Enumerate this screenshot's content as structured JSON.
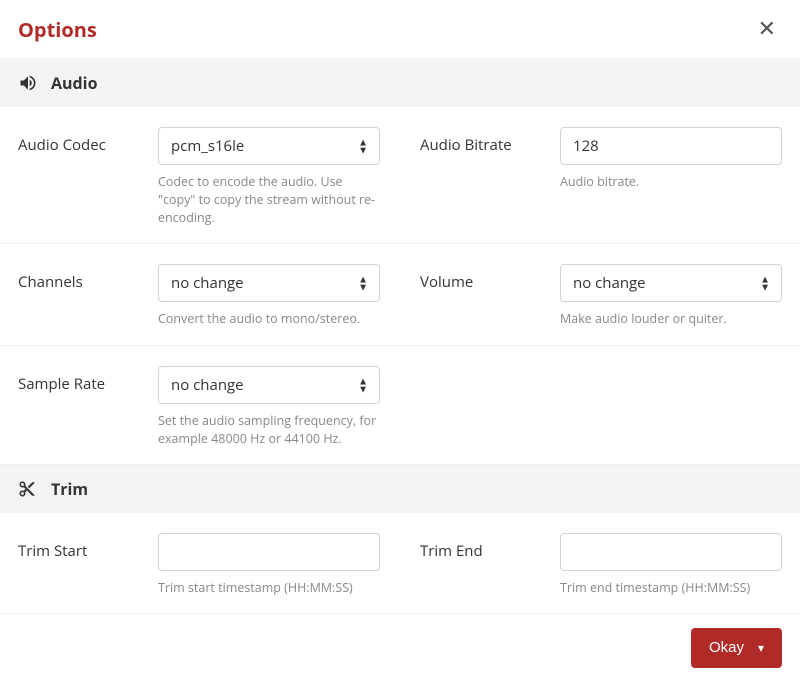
{
  "dialog": {
    "title": "Options"
  },
  "sections": {
    "audio": {
      "title": "Audio",
      "codec": {
        "label": "Audio Codec",
        "value": "pcm_s16le",
        "help": "Codec to encode the audio. Use \"copy\" to copy the stream without re-encoding."
      },
      "bitrate": {
        "label": "Audio Bitrate",
        "value": "128",
        "help": "Audio bitrate."
      },
      "channels": {
        "label": "Channels",
        "value": "no change",
        "help": "Convert the audio to mono/stereo."
      },
      "volume": {
        "label": "Volume",
        "value": "no change",
        "help": "Make audio louder or quiter."
      },
      "sample_rate": {
        "label": "Sample Rate",
        "value": "no change",
        "help": "Set the audio sampling frequency, for example 48000 Hz or 44100 Hz."
      }
    },
    "trim": {
      "title": "Trim",
      "start": {
        "label": "Trim Start",
        "value": "",
        "help": "Trim start timestamp (HH:MM:SS)"
      },
      "end": {
        "label": "Trim End",
        "value": "",
        "help": "Trim end timestamp (HH:MM:SS)"
      }
    }
  },
  "footer": {
    "okay": "Okay"
  }
}
